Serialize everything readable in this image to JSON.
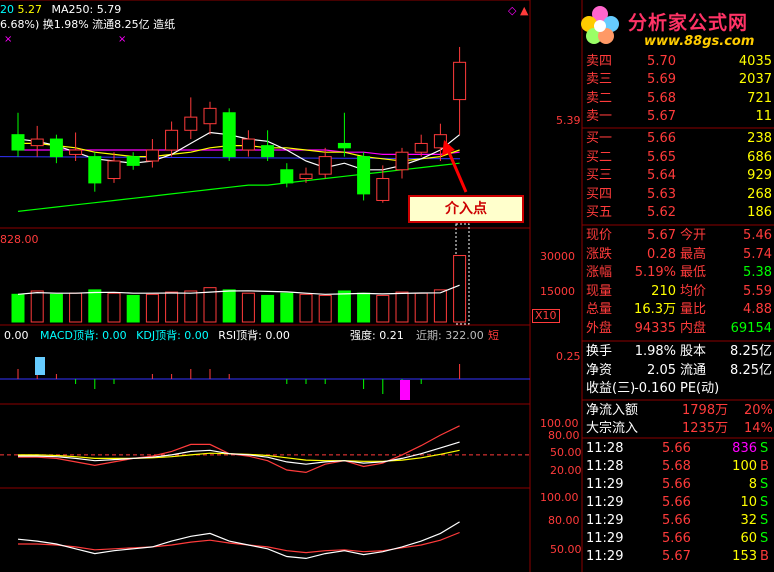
{
  "colors": {
    "up": "#ff3b3b",
    "down": "#00ff00",
    "grid": "#8b0000",
    "ma5": "#ffffff",
    "ma10": "#ffff00",
    "ma20": "#ff00ff",
    "ma60": "#00ff00",
    "ma250": "#3333ff"
  },
  "header": {
    "line1_left": "20",
    "line1_val": "5.27",
    "ma_label": "MA250:",
    "ma_val": "5.79",
    "line2": "6.68%) 换1.98% 流通8.25亿 造纸"
  },
  "logo": {
    "title": "分析家公式网",
    "url": "www.88gs.com",
    "icon_name": "flower-logo-icon"
  },
  "callout": {
    "text": "介入点"
  },
  "price_axis": {
    "label": "5.39"
  },
  "volume_panel": {
    "header": "828.00",
    "ticks": [
      "30000",
      "15000"
    ],
    "unit": "X10"
  },
  "macd_panel": {
    "prefix": "0.00",
    "labels": [
      "MACD顶背: 0.00",
      "KDJ顶背: 0.00",
      "RSI顶背: 0.00"
    ],
    "strength": "强度: 0.21",
    "recent": "近期: 322.00",
    "short": "短",
    "tick": "0.25"
  },
  "kdj_panel": {
    "ticks": [
      "100.00",
      "80.00",
      "50.00",
      "20.00"
    ]
  },
  "rsi_panel": {
    "ticks": [
      "100.00",
      "80.00",
      "50.00"
    ]
  },
  "order_book": {
    "asks": [
      {
        "label": "卖四",
        "price": "5.70",
        "vol": "4035"
      },
      {
        "label": "卖三",
        "price": "5.69",
        "vol": "2037"
      },
      {
        "label": "卖二",
        "price": "5.68",
        "vol": "721"
      },
      {
        "label": "卖一",
        "price": "5.67",
        "vol": "11"
      }
    ],
    "bids": [
      {
        "label": "买一",
        "price": "5.66",
        "vol": "238"
      },
      {
        "label": "买二",
        "price": "5.65",
        "vol": "686"
      },
      {
        "label": "买三",
        "price": "5.64",
        "vol": "929"
      },
      {
        "label": "买四",
        "price": "5.63",
        "vol": "268"
      },
      {
        "label": "买五",
        "price": "5.62",
        "vol": "186"
      }
    ]
  },
  "quote": [
    {
      "l1": "现价",
      "v1": "5.67",
      "l2": "今开",
      "v2": "5.46"
    },
    {
      "l1": "涨跌",
      "v1": "0.28",
      "l2": "最高",
      "v2": "5.74"
    },
    {
      "l1": "涨幅",
      "v1": "5.19%",
      "l2": "最低",
      "v2": "5.38"
    },
    {
      "l1": "现量",
      "v1": "210",
      "l2": "均价",
      "v2": "5.59"
    },
    {
      "l1": "总量",
      "v1": "16.3万",
      "l2": "量比",
      "v2": "4.88"
    },
    {
      "l1": "外盘",
      "v1": "94335",
      "l2": "内盘",
      "v2": "69154"
    }
  ],
  "fundamentals": [
    {
      "l1": "换手",
      "v1": "1.98%",
      "l2": "股本",
      "v2": "8.25亿"
    },
    {
      "l1": "净资",
      "v1": "2.05",
      "l2": "流通",
      "v2": "8.25亿"
    },
    {
      "l1": "收益(三)",
      "v1": "-0.160",
      "l2": "PE(动)",
      "v2": ""
    }
  ],
  "flows": [
    {
      "label": "净流入额",
      "val": "1798万",
      "pct": "20%"
    },
    {
      "label": "大宗流入",
      "val": "1235万",
      "pct": "14%"
    }
  ],
  "ticks": [
    {
      "time": "11:28",
      "price": "5.66",
      "vol": "836",
      "side": "S"
    },
    {
      "time": "11:28",
      "price": "5.68",
      "vol": "100",
      "side": "B"
    },
    {
      "time": "11:29",
      "price": "5.66",
      "vol": "8",
      "side": "S"
    },
    {
      "time": "11:29",
      "price": "5.66",
      "vol": "10",
      "side": "S"
    },
    {
      "time": "11:29",
      "price": "5.66",
      "vol": "32",
      "side": "S"
    },
    {
      "time": "11:29",
      "price": "5.66",
      "vol": "60",
      "side": "S"
    },
    {
      "time": "11:29",
      "price": "5.67",
      "vol": "153",
      "side": "B"
    }
  ],
  "chart_data": {
    "type": "candlestick",
    "candles": [
      {
        "o": 5.4,
        "c": 5.33,
        "h": 5.5,
        "l": 5.3
      },
      {
        "o": 5.35,
        "c": 5.38,
        "h": 5.44,
        "l": 5.3
      },
      {
        "o": 5.38,
        "c": 5.3,
        "h": 5.4,
        "l": 5.27
      },
      {
        "o": 5.31,
        "c": 5.33,
        "h": 5.41,
        "l": 5.28
      },
      {
        "o": 5.3,
        "c": 5.18,
        "h": 5.32,
        "l": 5.14
      },
      {
        "o": 5.2,
        "c": 5.28,
        "h": 5.32,
        "l": 5.18
      },
      {
        "o": 5.3,
        "c": 5.26,
        "h": 5.32,
        "l": 5.24
      },
      {
        "o": 5.28,
        "c": 5.33,
        "h": 5.38,
        "l": 5.25
      },
      {
        "o": 5.33,
        "c": 5.42,
        "h": 5.46,
        "l": 5.3
      },
      {
        "o": 5.42,
        "c": 5.48,
        "h": 5.57,
        "l": 5.38
      },
      {
        "o": 5.45,
        "c": 5.52,
        "h": 5.55,
        "l": 5.4
      },
      {
        "o": 5.5,
        "c": 5.3,
        "h": 5.52,
        "l": 5.28
      },
      {
        "o": 5.33,
        "c": 5.38,
        "h": 5.42,
        "l": 5.3
      },
      {
        "o": 5.35,
        "c": 5.3,
        "h": 5.42,
        "l": 5.28
      },
      {
        "o": 5.24,
        "c": 5.18,
        "h": 5.27,
        "l": 5.16
      },
      {
        "o": 5.2,
        "c": 5.22,
        "h": 5.25,
        "l": 5.18
      },
      {
        "o": 5.22,
        "c": 5.3,
        "h": 5.34,
        "l": 5.2
      },
      {
        "o": 5.36,
        "c": 5.34,
        "h": 5.5,
        "l": 5.3
      },
      {
        "o": 5.3,
        "c": 5.13,
        "h": 5.32,
        "l": 5.1
      },
      {
        "o": 5.1,
        "c": 5.2,
        "h": 5.26,
        "l": 5.09
      },
      {
        "o": 5.24,
        "c": 5.32,
        "h": 5.34,
        "l": 5.2
      },
      {
        "o": 5.32,
        "c": 5.36,
        "h": 5.4,
        "l": 5.3
      },
      {
        "o": 5.34,
        "c": 5.4,
        "h": 5.45,
        "l": 5.28
      },
      {
        "o": 5.56,
        "c": 5.73,
        "h": 5.8,
        "l": 5.4
      }
    ],
    "ma5": [
      5.38,
      5.37,
      5.35,
      5.32,
      5.29,
      5.28,
      5.27,
      5.28,
      5.31,
      5.36,
      5.41,
      5.4,
      5.38,
      5.37,
      5.33,
      5.28,
      5.25,
      5.27,
      5.24,
      5.24,
      5.26,
      5.29,
      5.33,
      5.4
    ],
    "ma10": [
      5.36,
      5.36,
      5.35,
      5.34,
      5.32,
      5.31,
      5.3,
      5.3,
      5.31,
      5.32,
      5.34,
      5.35,
      5.35,
      5.34,
      5.34,
      5.33,
      5.32,
      5.32,
      5.3,
      5.29,
      5.28,
      5.29,
      5.3,
      5.33
    ],
    "ma20": [
      5.33,
      5.33,
      5.33,
      5.33,
      5.33,
      5.33,
      5.33,
      5.33,
      5.33,
      5.33,
      5.33,
      5.33,
      5.33,
      5.33,
      5.33,
      5.33,
      5.33,
      5.32,
      5.32,
      5.31,
      5.31,
      5.31,
      5.31,
      5.32
    ],
    "ma60": [
      5.05,
      5.06,
      5.07,
      5.08,
      5.09,
      5.1,
      5.11,
      5.12,
      5.13,
      5.14,
      5.15,
      5.16,
      5.17,
      5.17,
      5.18,
      5.19,
      5.2,
      5.21,
      5.22,
      5.23,
      5.24,
      5.25,
      5.26,
      5.27
    ],
    "volume": [
      2.5,
      2.8,
      2.5,
      2.6,
      2.9,
      2.6,
      2.4,
      2.5,
      2.7,
      2.8,
      3.1,
      2.9,
      2.6,
      2.4,
      2.6,
      2.5,
      2.4,
      2.8,
      2.6,
      2.4,
      2.7,
      2.6,
      2.9,
      6.0
    ],
    "macd": [
      0.02,
      0.03,
      0.01,
      -0.01,
      -0.02,
      -0.01,
      0.0,
      0.01,
      0.01,
      0.02,
      0.02,
      0.01,
      0.0,
      0.0,
      -0.01,
      -0.01,
      -0.01,
      0.0,
      -0.02,
      -0.03,
      -0.02,
      -0.01,
      0.0,
      0.03
    ],
    "kdj_k": [
      48,
      48,
      47,
      44,
      40,
      42,
      44,
      46,
      50,
      56,
      58,
      52,
      50,
      46,
      38,
      34,
      38,
      40,
      36,
      38,
      44,
      52,
      62,
      72
    ],
    "kdj_d": [
      50,
      50,
      49,
      47,
      44,
      44,
      44,
      45,
      47,
      50,
      53,
      52,
      51,
      49,
      45,
      41,
      40,
      40,
      39,
      39,
      41,
      45,
      51,
      58
    ],
    "kdj_j": [
      46,
      46,
      44,
      38,
      32,
      38,
      44,
      48,
      56,
      68,
      68,
      52,
      48,
      40,
      24,
      20,
      34,
      40,
      30,
      36,
      50,
      66,
      84,
      100
    ],
    "rsi1": [
      60,
      58,
      55,
      50,
      45,
      48,
      50,
      52,
      58,
      63,
      66,
      58,
      54,
      50,
      42,
      40,
      45,
      48,
      44,
      47,
      52,
      58,
      66,
      78
    ],
    "rsi2": [
      55,
      55,
      54,
      52,
      49,
      50,
      51,
      52,
      54,
      57,
      59,
      56,
      54,
      52,
      48,
      46,
      48,
      49,
      47,
      48,
      51,
      54,
      59,
      67
    ]
  }
}
